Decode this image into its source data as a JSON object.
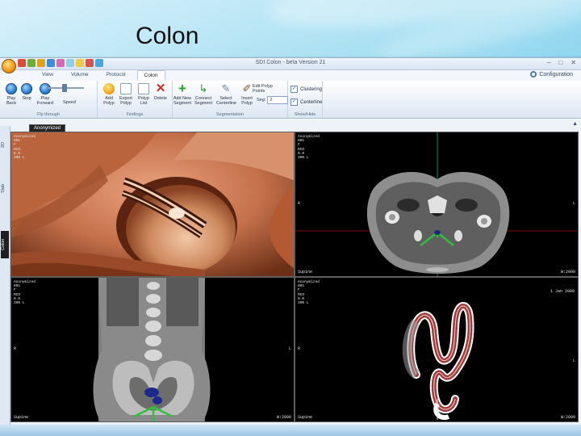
{
  "slide": {
    "title": "Colon"
  },
  "window": {
    "title": "SDI Colon - beta Version 21",
    "min_label": "–",
    "max_label": "□",
    "close_label": "✕"
  },
  "ribbon_tabs": [
    {
      "label": "View"
    },
    {
      "label": "Volume"
    },
    {
      "label": "Protocol"
    },
    {
      "label": "Colon"
    }
  ],
  "configuration": {
    "label": "Configuration"
  },
  "groups": {
    "fly_through": {
      "label": "Fly-through",
      "buttons": [
        {
          "label": "Play\nBack",
          "icon": "play-back-icon"
        },
        {
          "label": "Stop",
          "icon": "stop-icon"
        },
        {
          "label": "Play\nForward",
          "icon": "play-forward-icon"
        }
      ],
      "speed_label": "Speed",
      "speed_level": 0.45
    },
    "findings": {
      "label": "Findings",
      "buttons": [
        {
          "label": "Add\nPolyp",
          "icon": "add-polyp-icon"
        },
        {
          "label": "Export\nPolyp",
          "icon": "export-polyp-icon"
        },
        {
          "label": "Polyp\nList",
          "icon": "polyp-list-icon"
        },
        {
          "label": "Delete",
          "icon": "delete-icon"
        }
      ]
    },
    "segmentation": {
      "label": "Segmentation",
      "buttons": [
        {
          "label": "Add New\nSegment",
          "icon": "add-segment-icon"
        },
        {
          "label": "Connect\nSegment",
          "icon": "connect-segment-icon"
        },
        {
          "label": "Select\nCenterline",
          "icon": "select-centerline-icon"
        },
        {
          "label": "Insert\nPolyp",
          "icon": "insert-polyp-icon"
        }
      ],
      "edit_polyp": "Edit Polyp\nPoints",
      "segment_label": "Seg:",
      "segment_value": "2"
    },
    "show_hide": {
      "label": "Show/Hide",
      "items": [
        {
          "label": "Clustering",
          "checked": true
        },
        {
          "label": "Centerline",
          "checked": true
        }
      ]
    }
  },
  "side_tabs": [
    {
      "label": "2D",
      "active": false
    },
    {
      "label": "Slab",
      "active": false
    },
    {
      "label": "Colon",
      "active": true
    }
  ],
  "viewport_tab": {
    "label": "Anonymized"
  },
  "viewports": {
    "endoscopic": {
      "info": "Anonymized\n001\nF\nMCO\n0.0\n300 L",
      "footer": "",
      "top_right": ""
    },
    "axial": {
      "info": "Anonymized\n001\nF\nMCO\n0.0\n300 L",
      "side_right": "L",
      "side_left": "R",
      "footer": "Supine",
      "footer_right": "W:2000"
    },
    "coronal": {
      "info": "Anonymized\n001\nF\nMCO\n0.0\n300 L",
      "side_left": "R",
      "side_right": "L",
      "footer": "Supine",
      "footer_right": "W:2000"
    },
    "colon_map": {
      "info": "Anonymized\n001\nF\nMCO\n0.0\n300 L",
      "top_right": "1 Jan 2000",
      "side_left": "R",
      "side_right": "L",
      "footer": "Supine",
      "footer_right": "W:2000"
    }
  }
}
